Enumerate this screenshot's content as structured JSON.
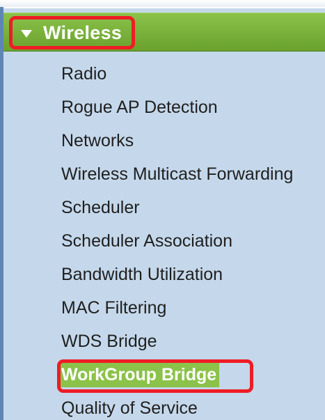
{
  "nav": {
    "section_title": "Wireless",
    "toggle_icon": "triangle-down-icon",
    "items": [
      {
        "label": "Radio",
        "active": false
      },
      {
        "label": "Rogue AP Detection",
        "active": false
      },
      {
        "label": "Networks",
        "active": false
      },
      {
        "label": "Wireless Multicast Forwarding",
        "active": false
      },
      {
        "label": "Scheduler",
        "active": false
      },
      {
        "label": "Scheduler Association",
        "active": false
      },
      {
        "label": "Bandwidth Utilization",
        "active": false
      },
      {
        "label": "MAC Filtering",
        "active": false
      },
      {
        "label": "WDS Bridge",
        "active": false
      },
      {
        "label": "WorkGroup Bridge",
        "active": true
      },
      {
        "label": "Quality of Service",
        "active": false
      }
    ]
  },
  "colors": {
    "panel_bg": "#c5d8eb",
    "header_green": "#7cb33e",
    "highlight_red": "#ee1c25",
    "active_bg": "#8bc24a"
  }
}
